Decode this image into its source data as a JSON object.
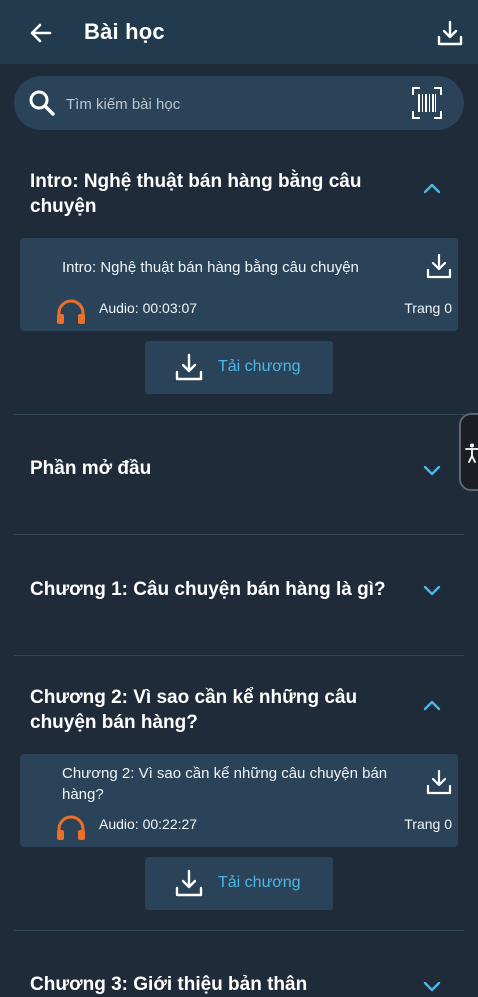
{
  "header": {
    "title": "Bài học",
    "back_icon": "arrow-left-icon",
    "download_icon": "download-icon"
  },
  "search": {
    "placeholder": "Tìm kiếm bài học",
    "value": "",
    "search_icon": "search-icon",
    "scan_icon": "barcode-scan-icon"
  },
  "sections": [
    {
      "title": "Intro: Nghệ thuật bán hàng bằng câu chuyện",
      "expanded": true,
      "lessons": [
        {
          "title": "Intro: Nghệ thuật bán hàng bằng câu chuyện",
          "audio": "Audio: 00:03:07",
          "page": "Trang 0"
        }
      ],
      "download_button": "Tải chương"
    },
    {
      "title": "Phần mở đầu",
      "expanded": false
    },
    {
      "title": "Chương 1: Câu chuyện bán hàng là gì?",
      "expanded": false
    },
    {
      "title": "Chương 2: Vì sao cần kể những câu chuyện bán hàng?",
      "expanded": true,
      "lessons": [
        {
          "title": "Chương 2: Vì sao cần kể những câu chuyện bán hàng?",
          "audio": "Audio: 00:22:27",
          "page": "Trang 0"
        }
      ],
      "download_button": "Tải chương"
    },
    {
      "title": "Chương 3: Giới thiệu bản thân",
      "expanded": false
    }
  ],
  "colors": {
    "background": "#1f2b38",
    "header": "#223a4e",
    "card": "#2a4358",
    "accent": "#4ab8ea",
    "headphone": "#e8702a"
  }
}
